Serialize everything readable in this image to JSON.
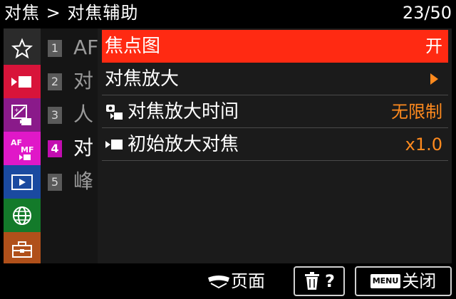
{
  "header": {
    "title": "对焦 > 对焦辅助",
    "page_indicator": "23/50"
  },
  "sidebar": {
    "items": [
      {
        "icon": "star-icon",
        "active": false
      },
      {
        "icon": "movie-camera-icon",
        "active": false,
        "color": "#d8143a"
      },
      {
        "icon": "exposure-icon",
        "active": false,
        "color": "#8a1a8a"
      },
      {
        "icon": "af-mf-icon",
        "active": true,
        "color": "#e018c8",
        "text_top": "AF",
        "text_bottom": "MF"
      },
      {
        "icon": "playback-icon",
        "active": false,
        "color": "#1a4aa0"
      },
      {
        "icon": "network-globe-icon",
        "active": false,
        "color": "#137a2a"
      },
      {
        "icon": "toolbox-icon",
        "active": false,
        "color": "#b0501a"
      }
    ]
  },
  "subtabs": {
    "items": [
      {
        "number": "1",
        "label": "AF"
      },
      {
        "number": "2",
        "label": "对"
      },
      {
        "number": "3",
        "label": "人"
      },
      {
        "number": "4",
        "label": "对",
        "active": true
      },
      {
        "number": "5",
        "label": "峰"
      }
    ]
  },
  "menu": {
    "rows": [
      {
        "label": "焦点图",
        "value": "开",
        "selected": true
      },
      {
        "label": "对焦放大",
        "value": "",
        "has_arrow": true
      },
      {
        "label": "对焦放大时间",
        "value": "无限制",
        "icon": "photo-movie-icon"
      },
      {
        "label": "初始放大对焦",
        "value": "x1.0",
        "icon": "movie-icon"
      }
    ]
  },
  "bottom_bar": {
    "page_label": "页面",
    "delete_help_label": "?",
    "menu_key": "MENU",
    "close_label": "关闭"
  },
  "colors": {
    "accent_selected": "#ff2a12",
    "value_orange": "#ff8a1e",
    "active_tab": "#c30db0"
  }
}
